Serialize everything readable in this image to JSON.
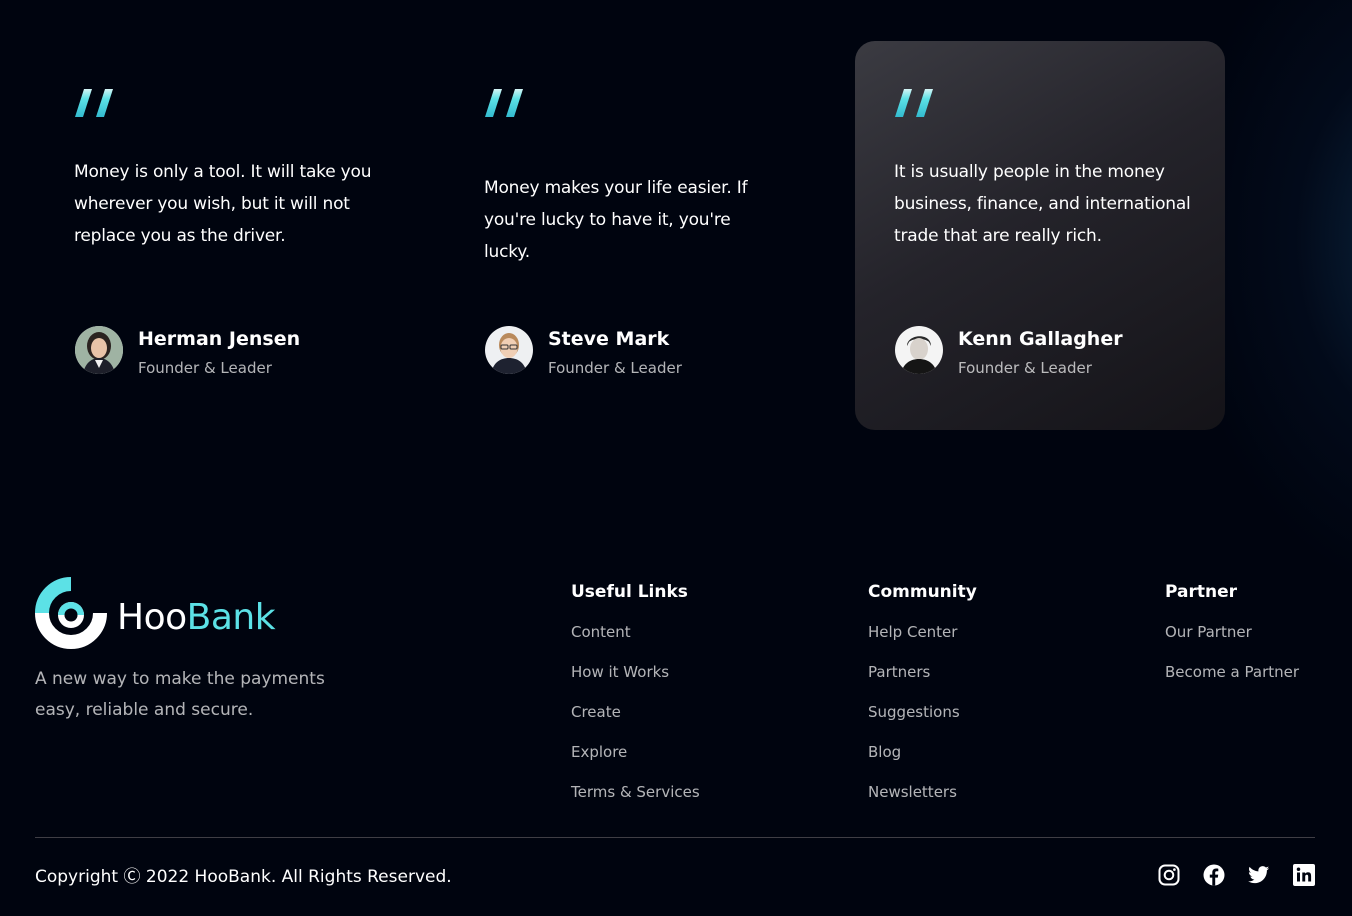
{
  "testimonials": [
    {
      "quote_icon": "quote-icon",
      "content": "Money is only a tool. It will take you wherever you wish, but it will not replace you as the driver.",
      "name": "Herman Jensen",
      "title": "Founder & Leader",
      "avatar": "avatar-photo",
      "highlighted": false
    },
    {
      "quote_icon": "quote-icon",
      "content": "Money makes your life easier. If you're lucky to have it, you're lucky.",
      "name": "Steve Mark",
      "title": "Founder & Leader",
      "avatar": "avatar-photo",
      "highlighted": false
    },
    {
      "quote_icon": "quote-icon",
      "content": "It is usually people in the money business, finance, and international trade that are really rich.",
      "name": "Kenn Gallagher",
      "title": "Founder & Leader",
      "avatar": "avatar-photo",
      "highlighted": true
    }
  ],
  "footer": {
    "logo": {
      "part1": "Hoo",
      "part2": "Bank",
      "icon": "hoobank-logo-icon"
    },
    "tagline": "A new way to make the payments easy, reliable and secure.",
    "columns": [
      {
        "title": "Useful Links",
        "links": [
          "Content",
          "How it Works",
          "Create",
          "Explore",
          "Terms & Services"
        ]
      },
      {
        "title": "Community",
        "links": [
          "Help Center",
          "Partners",
          "Suggestions",
          "Blog",
          "Newsletters"
        ]
      },
      {
        "title": "Partner",
        "links": [
          "Our Partner",
          "Become a Partner"
        ]
      }
    ],
    "copyright": "Copyright Ⓒ 2022 HooBank. All Rights Reserved.",
    "social": [
      "instagram-icon",
      "facebook-icon",
      "twitter-icon",
      "linkedin-icon"
    ]
  },
  "colors": {
    "background": "#00040f",
    "accent": "#5ce1e6",
    "muted_text": "rgba(255,255,255,0.7)",
    "card_highlight_from": "#3b3b42",
    "card_highlight_to": "#141318"
  }
}
